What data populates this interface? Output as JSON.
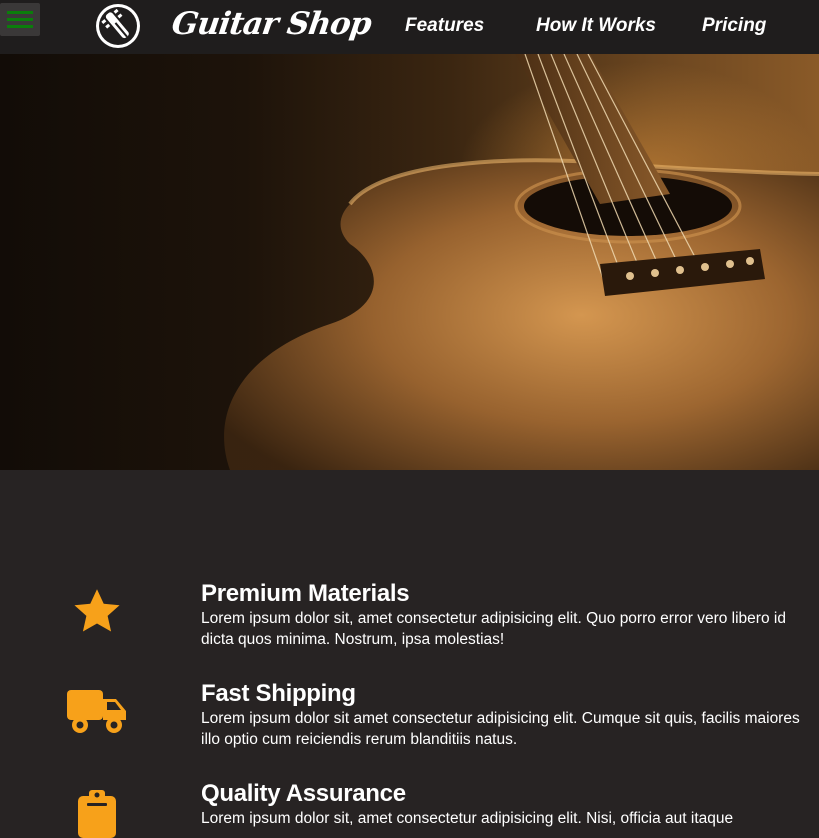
{
  "nav": {
    "brand": "Guitar Shop",
    "links": [
      "Features",
      "How It Works",
      "Pricing"
    ],
    "menu_icon": "hamburger-icon",
    "logo_icon": "guitar-headstock-icon"
  },
  "colors": {
    "navbar_bg": "#1f1d1d",
    "page_bg": "#272323",
    "accent_icon": "#f7a11a",
    "menu_green": "#0b7d0b"
  },
  "features": [
    {
      "icon": "star-icon",
      "title": "Premium Materials",
      "text": "Lorem ipsum dolor sit, amet consectetur adipisicing elit. Quo porro error vero libero id dicta quos minima. Nostrum, ipsa molestias!"
    },
    {
      "icon": "truck-icon",
      "title": "Fast Shipping",
      "text": "Lorem ipsum dolor sit amet consectetur adipisicing elit. Cumque sit quis, facilis maiores illo optio cum reiciendis rerum blanditiis natus."
    },
    {
      "icon": "clipboard-icon",
      "title": "Quality Assurance",
      "text": "Lorem ipsum dolor sit, amet consectetur adipisicing elit. Nisi, officia aut itaque"
    }
  ]
}
